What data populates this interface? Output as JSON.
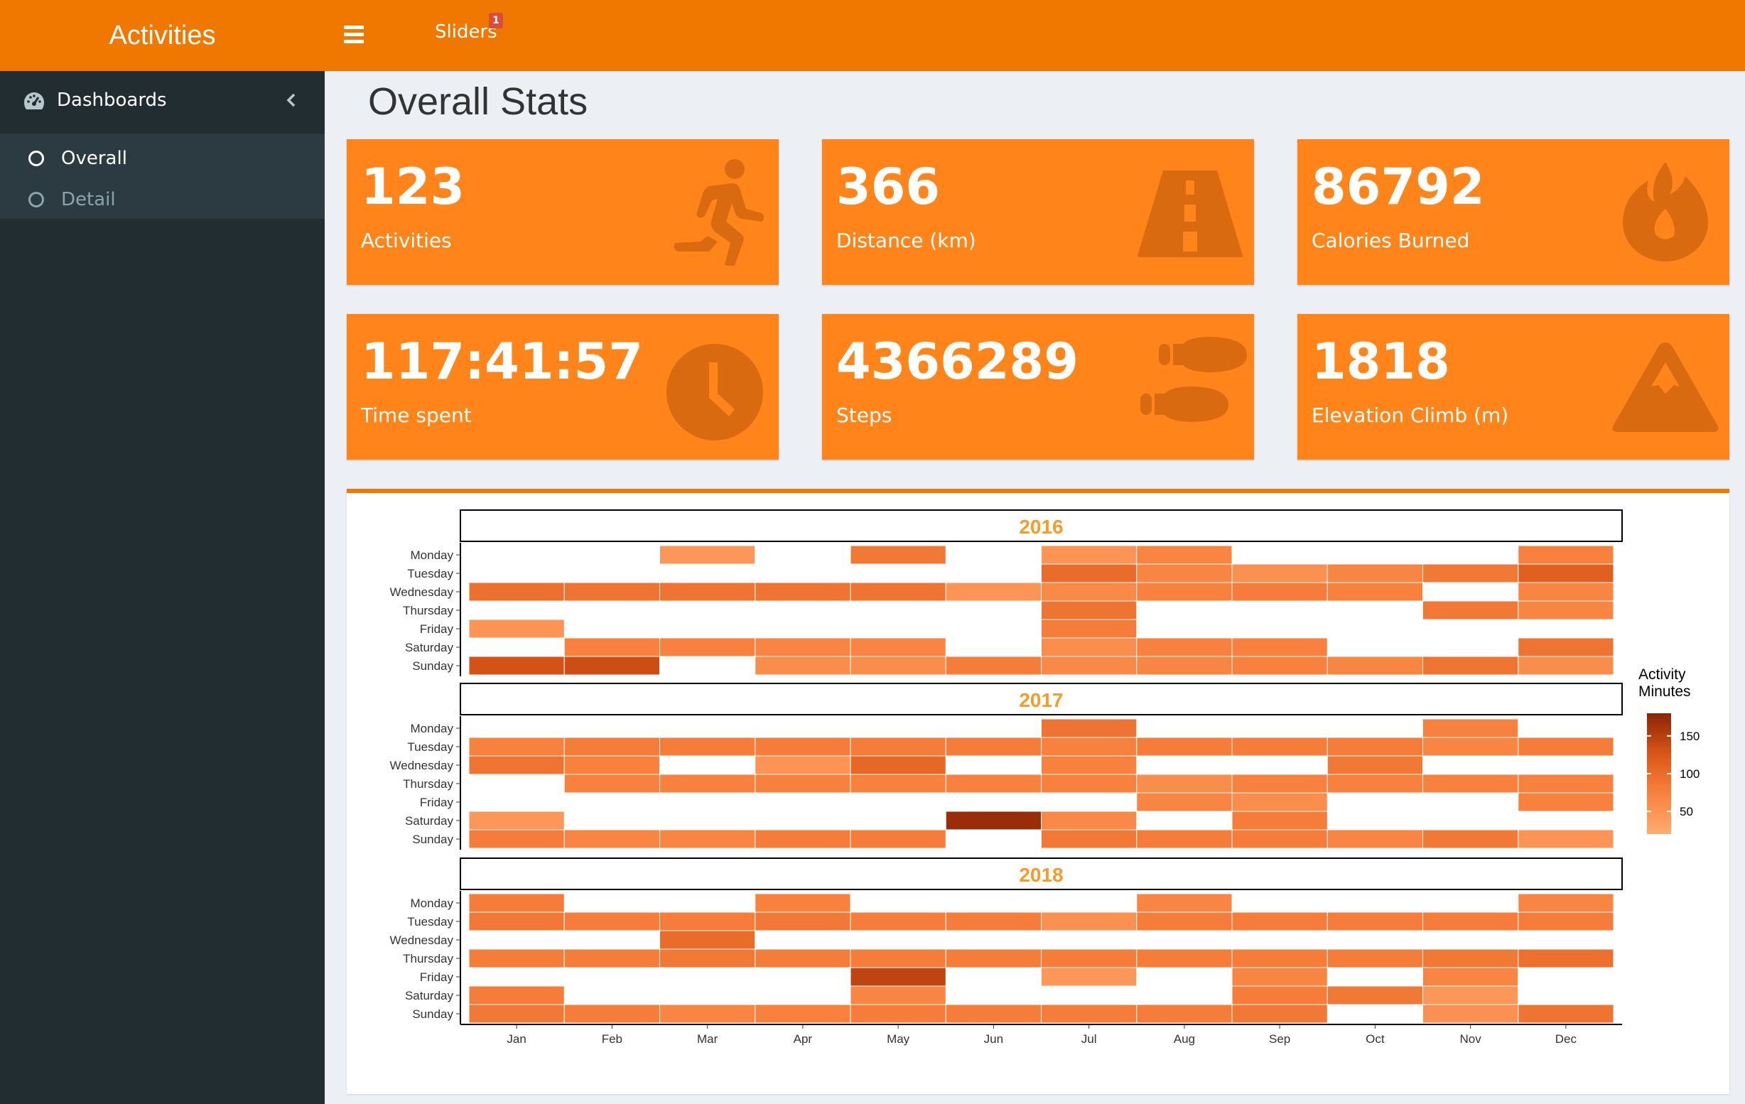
{
  "app": {
    "title": "Activities"
  },
  "navbar": {
    "sliders_label": "Sliders",
    "sliders_badge": "1"
  },
  "sidebar": {
    "header_label": "Dashboards",
    "items": [
      {
        "label": "Overall",
        "active": true
      },
      {
        "label": "Detail",
        "active": false
      }
    ]
  },
  "page_title": "Overall Stats",
  "value_boxes": [
    {
      "value": "123",
      "label": "Activities",
      "icon": "running-icon"
    },
    {
      "value": "366",
      "label": "Distance (km)",
      "icon": "road-icon"
    },
    {
      "value": "86792",
      "label": "Calories Burned",
      "icon": "fire-icon"
    },
    {
      "value": "117:41:57",
      "label": "Time spent",
      "icon": "clock-icon"
    },
    {
      "value": "4366289",
      "label": "Steps",
      "icon": "shoe-prints-icon"
    },
    {
      "value": "1818",
      "label": "Elevation Climb (m)",
      "icon": "mountain-icon"
    }
  ],
  "colors": {
    "accent": "#f07800",
    "box": "#ff851b",
    "sidebar": "#222d32",
    "icon": "#d96a10"
  },
  "chart_data": {
    "type": "heatmap",
    "months": [
      "Jan",
      "Feb",
      "Mar",
      "Apr",
      "May",
      "Jun",
      "Jul",
      "Aug",
      "Sep",
      "Oct",
      "Nov",
      "Dec"
    ],
    "days": [
      "Monday",
      "Tuesday",
      "Wednesday",
      "Thursday",
      "Friday",
      "Saturday",
      "Sunday"
    ],
    "legend": {
      "title_lines": [
        "Activity",
        "Minutes"
      ],
      "ticks": [
        50,
        100,
        150
      ],
      "range": [
        20,
        180
      ]
    },
    "panels": [
      {
        "year": "2016",
        "values": [
          [
            null,
            null,
            45,
            null,
            85,
            null,
            50,
            70,
            null,
            null,
            null,
            75
          ],
          [
            null,
            null,
            null,
            null,
            null,
            null,
            100,
            70,
            55,
            70,
            85,
            115
          ],
          [
            95,
            90,
            90,
            90,
            90,
            50,
            65,
            75,
            80,
            75,
            null,
            70
          ],
          [
            null,
            null,
            null,
            null,
            null,
            null,
            90,
            null,
            null,
            null,
            85,
            70
          ],
          [
            50,
            null,
            null,
            null,
            null,
            null,
            80,
            null,
            null,
            null,
            null,
            null
          ],
          [
            null,
            75,
            75,
            70,
            70,
            null,
            60,
            75,
            75,
            null,
            null,
            90
          ],
          [
            130,
            135,
            null,
            60,
            60,
            80,
            65,
            70,
            75,
            70,
            90,
            60
          ]
        ]
      },
      {
        "year": "2017",
        "values": [
          [
            null,
            null,
            null,
            null,
            null,
            null,
            90,
            null,
            null,
            null,
            75,
            null
          ],
          [
            75,
            80,
            80,
            80,
            80,
            80,
            75,
            80,
            80,
            80,
            70,
            80
          ],
          [
            90,
            75,
            null,
            50,
            105,
            null,
            75,
            null,
            null,
            85,
            null,
            null
          ],
          [
            null,
            75,
            75,
            75,
            75,
            75,
            75,
            60,
            75,
            75,
            75,
            75
          ],
          [
            null,
            null,
            null,
            null,
            null,
            null,
            null,
            70,
            60,
            null,
            null,
            75
          ],
          [
            45,
            null,
            null,
            null,
            null,
            170,
            65,
            null,
            80,
            null,
            null,
            null
          ],
          [
            80,
            70,
            70,
            80,
            80,
            null,
            85,
            80,
            80,
            70,
            85,
            50
          ]
        ]
      },
      {
        "year": "2018",
        "values": [
          [
            80,
            null,
            null,
            75,
            null,
            null,
            null,
            70,
            null,
            null,
            null,
            70
          ],
          [
            85,
            80,
            80,
            85,
            80,
            80,
            55,
            80,
            80,
            80,
            80,
            80
          ],
          [
            null,
            null,
            100,
            null,
            null,
            null,
            null,
            null,
            null,
            null,
            null,
            null
          ],
          [
            80,
            80,
            85,
            80,
            80,
            80,
            80,
            80,
            80,
            80,
            85,
            95
          ],
          [
            null,
            null,
            null,
            null,
            145,
            null,
            45,
            null,
            70,
            null,
            70,
            null
          ],
          [
            80,
            null,
            null,
            null,
            70,
            null,
            null,
            null,
            80,
            85,
            45,
            null
          ],
          [
            85,
            80,
            70,
            75,
            80,
            80,
            80,
            80,
            85,
            null,
            55,
            90
          ]
        ]
      }
    ],
    "x_ticks": [
      "Jan",
      "Feb",
      "Mar",
      "Apr",
      "May",
      "Jun",
      "Jul",
      "Aug",
      "Sep",
      "Oct",
      "Nov",
      "Dec"
    ]
  }
}
